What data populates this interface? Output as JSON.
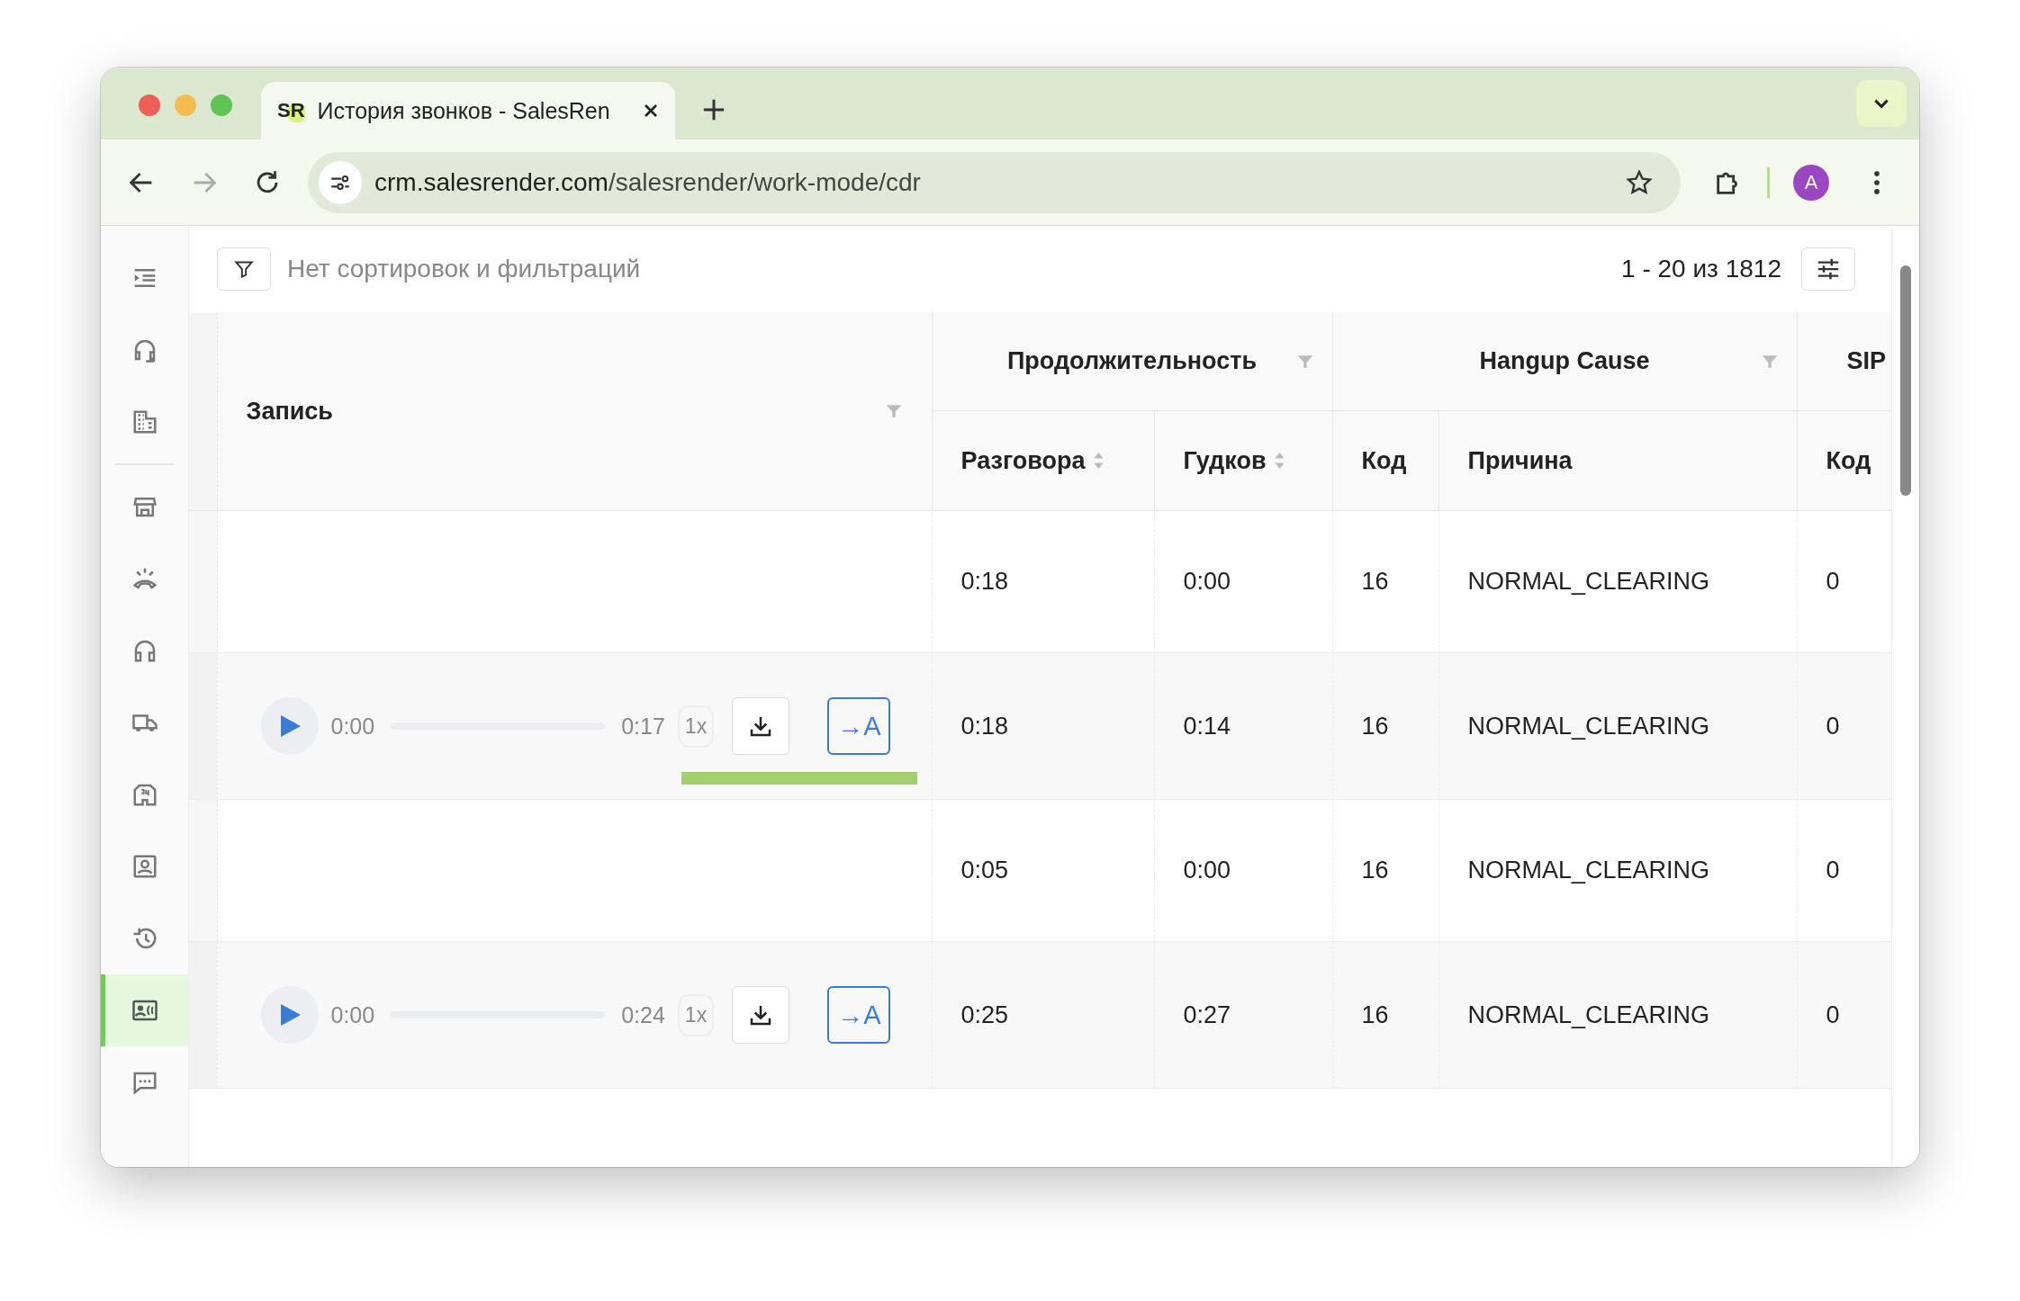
{
  "browser": {
    "tab_title": "История звонков - SalesRen",
    "tab_logo": "SR",
    "url_host": "crm.salesrender.com",
    "url_path": "/salesrender/work-mode/cdr",
    "avatar": "A"
  },
  "sidebar": {
    "items": [
      {
        "kind": "menu",
        "selected": false
      },
      {
        "kind": "headset",
        "selected": false
      },
      {
        "kind": "building",
        "selected": false
      },
      {
        "kind": "divider"
      },
      {
        "kind": "store",
        "selected": false
      },
      {
        "kind": "ringing",
        "selected": false
      },
      {
        "kind": "headphones",
        "selected": false
      },
      {
        "kind": "truck",
        "selected": false
      },
      {
        "kind": "building24",
        "selected": false
      },
      {
        "kind": "contact",
        "selected": false
      },
      {
        "kind": "history",
        "selected": false
      },
      {
        "kind": "callcard",
        "selected": true
      },
      {
        "kind": "chat",
        "selected": false
      }
    ]
  },
  "toolbar": {
    "filter_text": "Нет сортировок и фильтраций",
    "range": "1 - 20 из 1812"
  },
  "table": {
    "record_header": "Запись",
    "groups": [
      {
        "label": "Продолжительность",
        "filterable": true,
        "columns": [
          {
            "label": "Разговора",
            "sortable": true
          },
          {
            "label": "Гудков",
            "sortable": true
          }
        ]
      },
      {
        "label": "Hangup Cause",
        "filterable": true,
        "columns": [
          {
            "label": "Код",
            "sortable": false
          },
          {
            "label": "Причина",
            "sortable": false
          }
        ]
      },
      {
        "label": "SIP",
        "columns": [
          {
            "label": "Код",
            "sortable": false
          }
        ]
      }
    ],
    "rows": [
      {
        "recording": {
          "kind": "none"
        },
        "cells": [
          "0:18",
          "0:00",
          "16",
          "NORMAL_CLEARING",
          "0"
        ]
      },
      {
        "recording": {
          "kind": "player",
          "start": "0:00",
          "end": "0:17",
          "speed": "1x",
          "translate": "→A",
          "highlight": true
        },
        "cells": [
          "0:18",
          "0:14",
          "16",
          "NORMAL_CLEARING",
          "0"
        ]
      },
      {
        "recording": {
          "kind": "none"
        },
        "cells": [
          "0:05",
          "0:00",
          "16",
          "NORMAL_CLEARING",
          "0"
        ]
      },
      {
        "recording": {
          "kind": "player",
          "start": "0:00",
          "end": "0:24",
          "speed": "1x",
          "translate": "→A",
          "highlight": false
        },
        "cells": [
          "0:25",
          "0:27",
          "16",
          "NORMAL_CLEARING",
          "0"
        ]
      }
    ]
  }
}
